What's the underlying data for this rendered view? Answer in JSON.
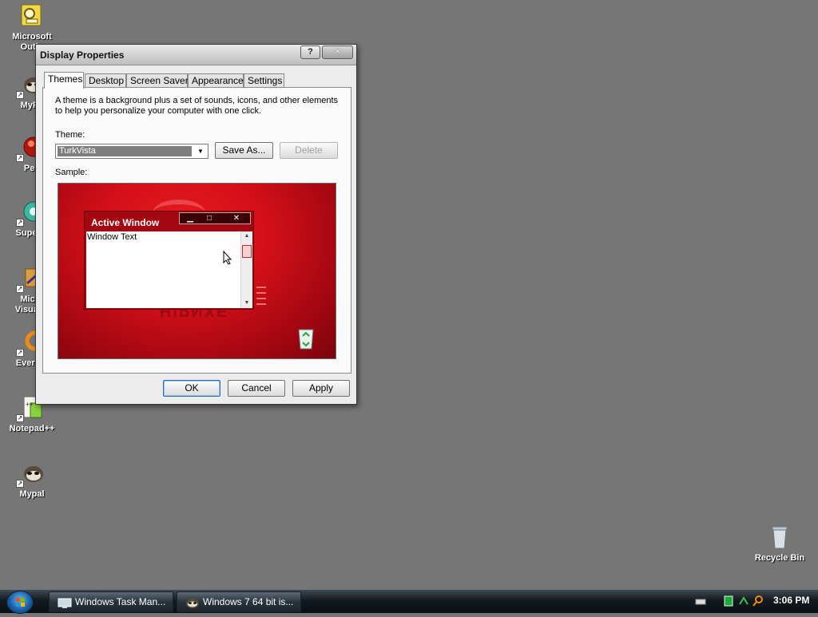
{
  "desktop": {
    "icons": [
      {
        "name": "desktop-icon-microsoft-outlook",
        "label": "Microsoft\nOutlo",
        "icon": "outlook-icon"
      },
      {
        "name": "desktop-icon-mypal-top",
        "label": "MyPa",
        "icon": "raccoon-icon"
      },
      {
        "name": "desktop-icon-pegasus",
        "label": "Peg",
        "icon": "pegasus-icon"
      },
      {
        "name": "desktop-icon-supermium",
        "label": "Superm",
        "icon": "supermium-icon"
      },
      {
        "name": "desktop-icon-visual-studio",
        "label": "Micro\nVisual S",
        "icon": "visual-studio-icon"
      },
      {
        "name": "desktop-icon-everything",
        "label": "Everyth",
        "icon": "everything-icon"
      },
      {
        "name": "desktop-icon-notepadpp",
        "label": "Notepad++",
        "icon": "notepadpp-icon"
      },
      {
        "name": "desktop-icon-mypal",
        "label": "Mypal",
        "icon": "raccoon-icon"
      },
      {
        "name": "desktop-icon-recycle-bin",
        "label": "Recycle Bin",
        "icon": "recycle-bin-icon"
      }
    ]
  },
  "dialog": {
    "title": "Display Properties",
    "help_label": "?",
    "close_label": "✕",
    "tabs": [
      {
        "label": "Themes",
        "active": true
      },
      {
        "label": "Desktop",
        "active": false
      },
      {
        "label": "Screen Saver",
        "active": false
      },
      {
        "label": "Appearance",
        "active": false
      },
      {
        "label": "Settings",
        "active": false
      }
    ],
    "description": "A theme is a background plus a set of sounds, icons, and other elements to help you personalize your computer with one click.",
    "theme_label": "Theme:",
    "theme_value": "TurkVista",
    "save_as_label": "Save As...",
    "delete_label": "Delete",
    "sample_label": "Sample:",
    "sample": {
      "window_title": "Active Window",
      "window_text": "Window Text",
      "minimize": "▁",
      "maximize": "□",
      "close": "✕",
      "reflection": "HIPNXE"
    },
    "ok_label": "OK",
    "cancel_label": "Cancel",
    "apply_label": "Apply"
  },
  "taskbar": {
    "buttons": [
      {
        "label": "Windows Task Man...",
        "icon": "task-manager-icon"
      },
      {
        "label": "Windows 7 64 bit is...",
        "icon": "mypal-browser-icon"
      }
    ],
    "clock": "3:06 PM"
  },
  "colors": {
    "desktop_bg": "#767676",
    "theme_red": "#d20f18",
    "taskbar": "#131a1f"
  }
}
